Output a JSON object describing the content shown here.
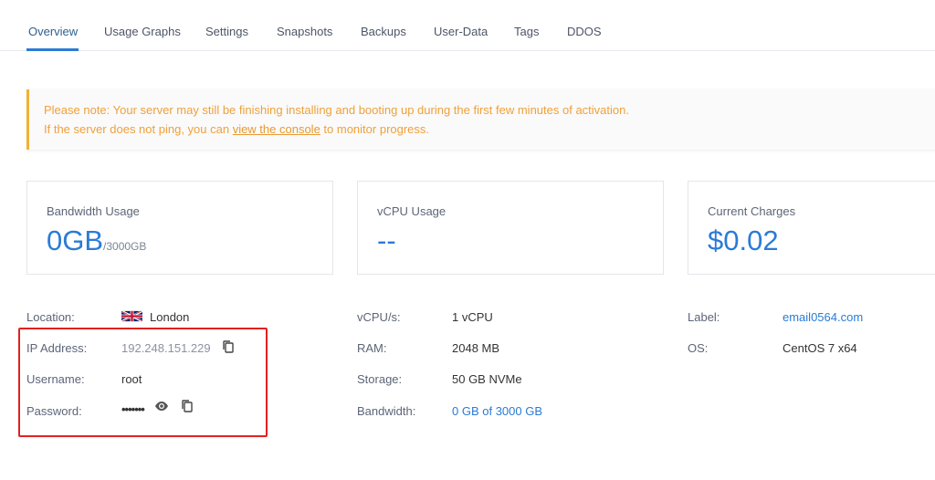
{
  "tabs": [
    {
      "label": "Overview",
      "active": true
    },
    {
      "label": "Usage Graphs"
    },
    {
      "label": "Settings"
    },
    {
      "label": "Snapshots"
    },
    {
      "label": "Backups"
    },
    {
      "label": "User-Data"
    },
    {
      "label": "Tags"
    },
    {
      "label": "DDOS"
    }
  ],
  "notice": {
    "line1": "Please note: Your server may still be finishing installing and booting up during the first few minutes of activation.",
    "line2_prefix": "If the server does not ping, you can ",
    "line2_link": "view the console",
    "line2_suffix": " to monitor progress."
  },
  "cards": {
    "bandwidth": {
      "label": "Bandwidth Usage",
      "value": "0GB",
      "unit": "/3000GB"
    },
    "vcpu": {
      "label": "vCPU Usage",
      "value": "--"
    },
    "charges": {
      "label": "Current Charges",
      "value": "$0.02"
    }
  },
  "info": {
    "location": {
      "label": "Location:",
      "value": "London",
      "flag": "uk-flag-icon"
    },
    "ip": {
      "label": "IP Address:",
      "value": "192.248.151.229"
    },
    "username": {
      "label": "Username:",
      "value": "root"
    },
    "password": {
      "label": "Password:",
      "value": "•••••••"
    },
    "vcpus": {
      "label": "vCPU/s:",
      "value": "1 vCPU"
    },
    "ram": {
      "label": "RAM:",
      "value": "2048 MB"
    },
    "storage": {
      "label": "Storage:",
      "value": "50 GB NVMe"
    },
    "bandwidth": {
      "label": "Bandwidth:",
      "value": "0 GB of 3000 GB"
    },
    "server_label": {
      "label": "Label:",
      "value": "email0564.com"
    },
    "os": {
      "label": "OS:",
      "value": "CentOS 7 x64"
    }
  },
  "colors": {
    "accent": "#2b7bd6",
    "notice_text": "#f0a03a",
    "notice_border": "#f2b233",
    "highlight": "#e0221f"
  },
  "icons": {
    "copy": "copy-icon",
    "eye": "eye-icon"
  }
}
